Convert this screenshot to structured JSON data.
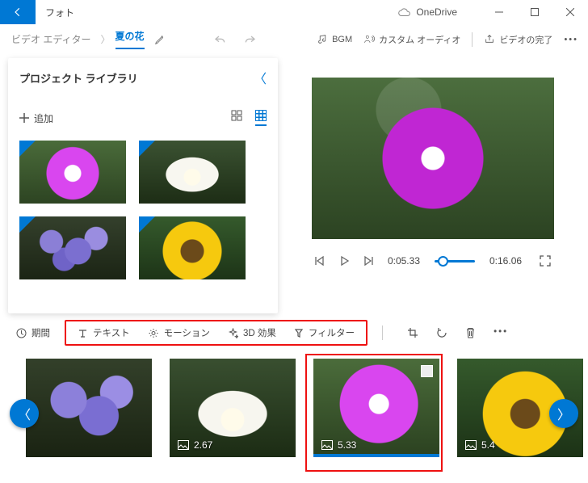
{
  "title_bar": {
    "app_name": "フォト",
    "cloud_label": "OneDrive"
  },
  "breadcrumb": {
    "root": "ビデオ エディター",
    "current": "夏の花"
  },
  "header_tools": {
    "bgm": "BGM",
    "custom_audio": "カスタム オーディオ",
    "finish": "ビデオの完了"
  },
  "library": {
    "title": "プロジェクト ライブラリ",
    "add_label": "追加"
  },
  "player": {
    "current_time": "0:05.33",
    "total_time": "0:16.06"
  },
  "storyboard_tools": {
    "duration": "期間",
    "text": "テキスト",
    "motion": "モーション",
    "fx3d": "3D 効果",
    "filter": "フィルター"
  },
  "clips": {
    "c2_dur": "2.67",
    "c3_dur": "5.33",
    "c4_dur": "5.4"
  }
}
